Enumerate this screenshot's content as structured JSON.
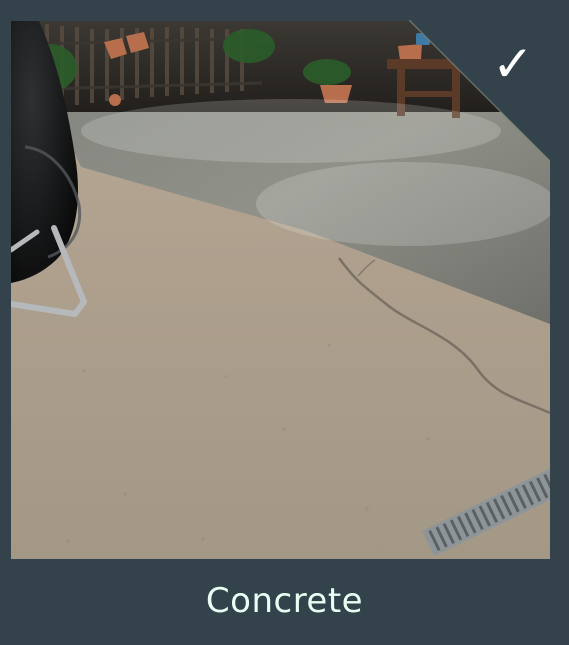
{
  "option": {
    "label": "Concrete",
    "selected": true,
    "selected_indicator_icon": "checkmark-icon",
    "image_description_icon": "wet-concrete-patio-photo"
  },
  "colors": {
    "card_background": "#34424b",
    "caption_text": "#e9fff4",
    "checkmark": "#ffffff"
  }
}
